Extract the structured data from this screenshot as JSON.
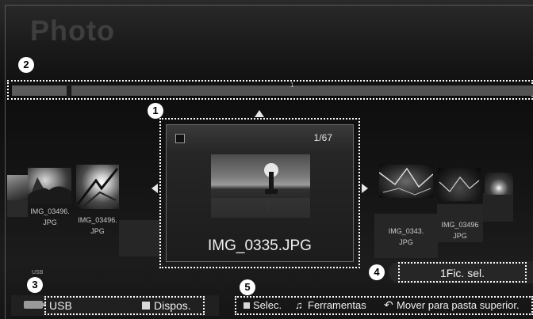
{
  "page": {
    "title": "Photo"
  },
  "callouts": {
    "c1": "1",
    "c2": "2",
    "c3": "3",
    "c4": "4",
    "c5": "5"
  },
  "timeline": {
    "marker_label": "1"
  },
  "viewer": {
    "counter": "1/67",
    "filename": "IMG_0335.JPG"
  },
  "left_thumbs": [
    {
      "caption_line1": "IMG_03496.",
      "caption_line2": "JPG"
    },
    {
      "caption_line1": "IMG_03496.",
      "caption_line2": "JPG"
    }
  ],
  "right_thumbs": [
    {
      "caption_line1": "IMG_0343.",
      "caption_line2": "JPG"
    },
    {
      "caption_line1": "IMG_03496",
      "caption_line2": "JPG"
    }
  ],
  "device": {
    "small_label": "USB",
    "name": "USB",
    "action": "Dispos."
  },
  "selection": {
    "label": "1Fic. sel."
  },
  "help_bar": {
    "select": "Selec.",
    "tools": "Ferramentas",
    "up": "Mover para pasta superior."
  }
}
